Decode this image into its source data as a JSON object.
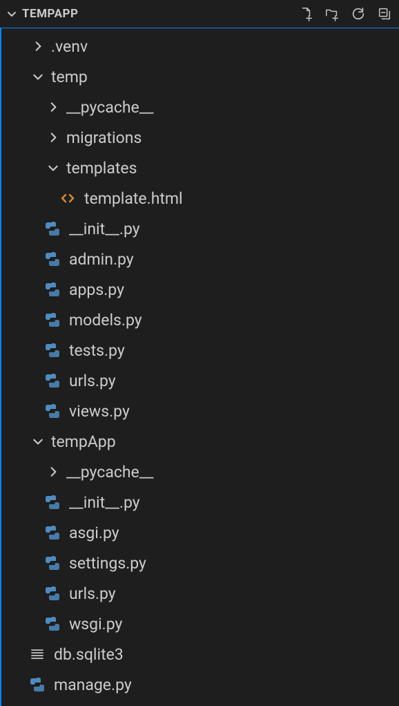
{
  "header": {
    "title": "TEMPAPP"
  },
  "tree": {
    "items": [
      {
        "depth": 0,
        "kind": "folder",
        "expanded": false,
        "label": ".venv"
      },
      {
        "depth": 0,
        "kind": "folder",
        "expanded": true,
        "label": "temp"
      },
      {
        "depth": 1,
        "kind": "folder",
        "expanded": false,
        "label": "__pycache__"
      },
      {
        "depth": 1,
        "kind": "folder",
        "expanded": false,
        "label": "migrations"
      },
      {
        "depth": 1,
        "kind": "folder",
        "expanded": true,
        "label": "templates"
      },
      {
        "depth": 2,
        "kind": "html",
        "label": "template.html"
      },
      {
        "depth": 1,
        "kind": "python",
        "label": "__init__.py"
      },
      {
        "depth": 1,
        "kind": "python",
        "label": "admin.py"
      },
      {
        "depth": 1,
        "kind": "python",
        "label": "apps.py"
      },
      {
        "depth": 1,
        "kind": "python",
        "label": "models.py"
      },
      {
        "depth": 1,
        "kind": "python",
        "label": "tests.py"
      },
      {
        "depth": 1,
        "kind": "python",
        "label": "urls.py"
      },
      {
        "depth": 1,
        "kind": "python",
        "label": "views.py"
      },
      {
        "depth": 0,
        "kind": "folder",
        "expanded": true,
        "label": "tempApp"
      },
      {
        "depth": 1,
        "kind": "folder",
        "expanded": false,
        "label": "__pycache__"
      },
      {
        "depth": 1,
        "kind": "python",
        "label": "__init__.py"
      },
      {
        "depth": 1,
        "kind": "python",
        "label": "asgi.py"
      },
      {
        "depth": 1,
        "kind": "python",
        "label": "settings.py"
      },
      {
        "depth": 1,
        "kind": "python",
        "label": "urls.py"
      },
      {
        "depth": 1,
        "kind": "python",
        "label": "wsgi.py"
      },
      {
        "depth": 0,
        "kind": "db",
        "label": "db.sqlite3"
      },
      {
        "depth": 0,
        "kind": "python",
        "label": "manage.py"
      }
    ]
  }
}
